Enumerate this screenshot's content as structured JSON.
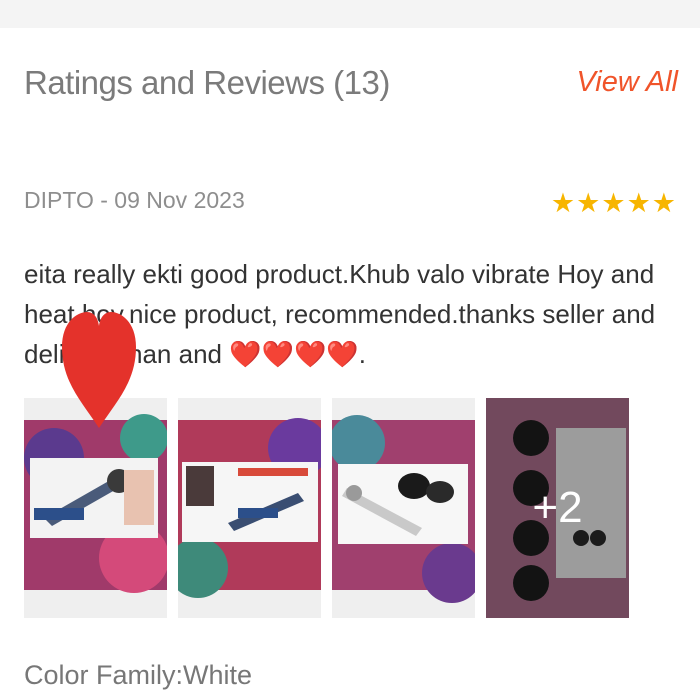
{
  "header": {
    "title": "Ratings and Reviews (13)",
    "view_all": "View All"
  },
  "review": {
    "author_date": "DIPTO - 09 Nov 2023",
    "rating": 5,
    "text_main": "eita really ekti good product.Khub valo vibrate Hoy and heat hoy.nice product, recommended.thanks seller and delivery man and ",
    "text_hearts": "❤️❤️❤️❤️",
    "text_end": "."
  },
  "photos": {
    "count_more": "+2",
    "items": [
      "photo-1",
      "photo-2",
      "photo-3",
      "photo-4"
    ]
  },
  "product_variant": "Color Family:White",
  "colors": {
    "accent": "#f0542a",
    "star": "#f7b500",
    "heart": "#e4322b"
  }
}
